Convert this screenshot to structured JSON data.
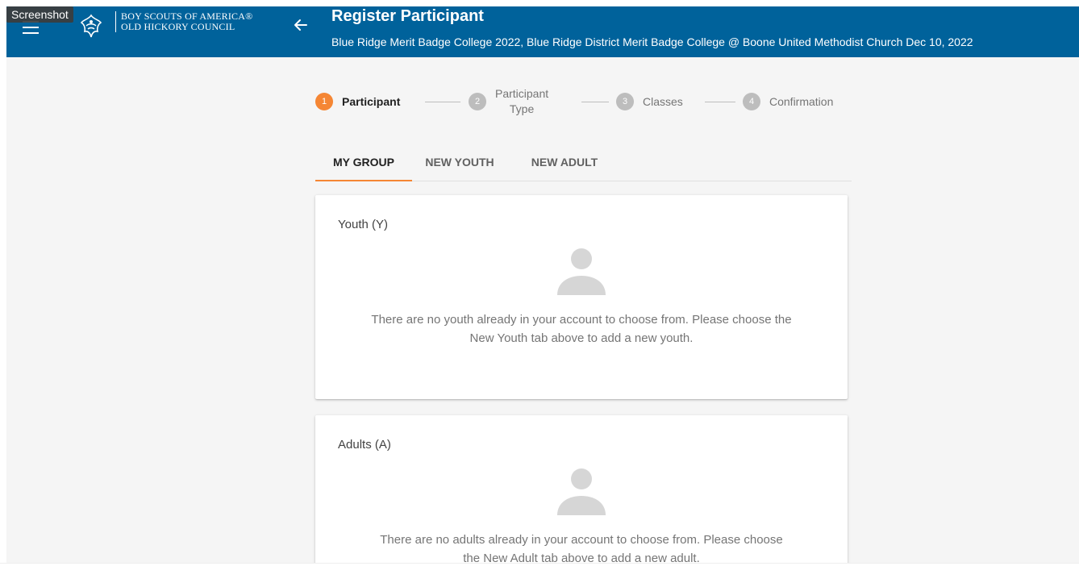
{
  "header": {
    "org_line1": "BOY SCOUTS OF AMERICA®",
    "org_line2": "OLD HICKORY COUNCIL",
    "title": "Register Participant",
    "subtitle": "Blue Ridge Merit Badge College 2022, Blue Ridge District Merit Badge College @ Boone United Methodist Church Dec 10, 2022",
    "menu_icon": "hamburger-menu-icon",
    "back_icon": "arrow-left-icon",
    "color": "#00629b"
  },
  "overlay": {
    "badge": "Screenshot"
  },
  "stepper": {
    "active_color": "#f58634",
    "steps": [
      {
        "number": "1",
        "label": "Participant"
      },
      {
        "number": "2",
        "label_line1": "Participant",
        "label_line2": "Type"
      },
      {
        "number": "3",
        "label": "Classes"
      },
      {
        "number": "4",
        "label": "Confirmation"
      }
    ]
  },
  "tabs": {
    "items": [
      {
        "label": "MY GROUP"
      },
      {
        "label": "NEW YOUTH"
      },
      {
        "label": "NEW ADULT"
      }
    ],
    "active": "MY GROUP"
  },
  "youth_card": {
    "title": "Youth (Y)",
    "icon": "person-placeholder-icon",
    "line1": "There are no youth already in your account to choose from. Please choose the",
    "line2": "New Youth tab above to add a new youth."
  },
  "adults_card": {
    "title": "Adults (A)",
    "icon": "person-placeholder-icon",
    "line1": "There are no adults already in your account to choose from. Please choose",
    "line2": "the New Adult tab above to add a new adult."
  }
}
